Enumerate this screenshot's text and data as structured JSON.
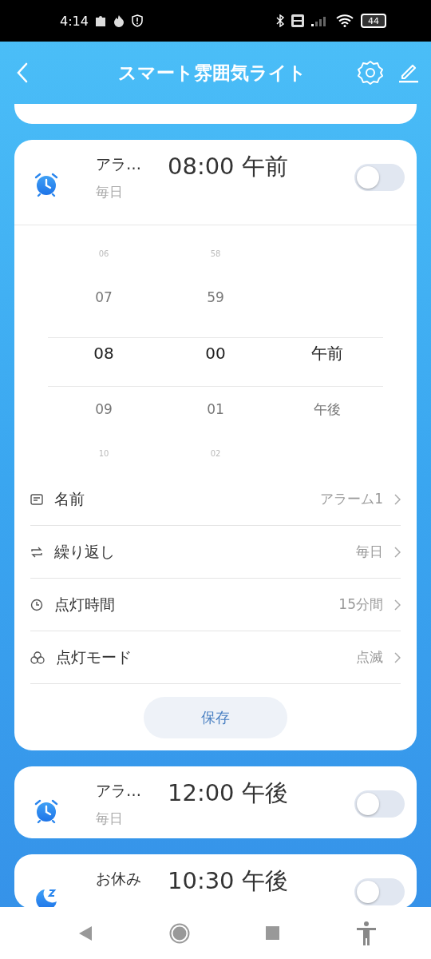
{
  "status_bar": {
    "time": "4:14",
    "battery": "44"
  },
  "header": {
    "title": "スマート雰囲気ライト"
  },
  "alarms": [
    {
      "kind": "alarm",
      "name": "アラ…",
      "time": "08:00 午前",
      "repeat": "毎日",
      "on": false,
      "expanded": true,
      "picker": {
        "columns": [
          {
            "items": [
              {
                "text": "06",
                "kind": "far",
                "selected": false
              },
              {
                "text": "07",
                "kind": "near",
                "selected": false
              },
              {
                "text": "08",
                "selected": true
              },
              {
                "text": "09",
                "kind": "near",
                "selected": false
              },
              {
                "text": "10",
                "kind": "far",
                "selected": false
              }
            ]
          },
          {
            "items": [
              {
                "text": "58",
                "kind": "far",
                "selected": false
              },
              {
                "text": "59",
                "kind": "near",
                "selected": false
              },
              {
                "text": "00",
                "selected": true
              },
              {
                "text": "01",
                "kind": "near",
                "selected": false
              },
              {
                "text": "02",
                "kind": "far",
                "selected": false
              }
            ]
          },
          {
            "items": [
              {
                "text": "午前",
                "selected": true
              },
              {
                "text": "午後",
                "kind": "near",
                "selected": false
              }
            ]
          }
        ]
      },
      "settings": [
        {
          "kind": "name",
          "label": "名前",
          "value": "アラーム1"
        },
        {
          "kind": "repeat",
          "label": "繰り返し",
          "value": "毎日"
        },
        {
          "kind": "duration",
          "label": "点灯時間",
          "value": "15分間"
        },
        {
          "kind": "mode",
          "label": "点灯モード",
          "value": "点滅"
        }
      ],
      "save_button": "保存"
    },
    {
      "kind": "alarm",
      "name": "アラ…",
      "time": "12:00 午後",
      "repeat": "毎日",
      "on": false,
      "expanded": false
    },
    {
      "kind": "sleep",
      "name": "お休み",
      "time": "10:30 午後",
      "on": false,
      "expanded": false
    }
  ]
}
